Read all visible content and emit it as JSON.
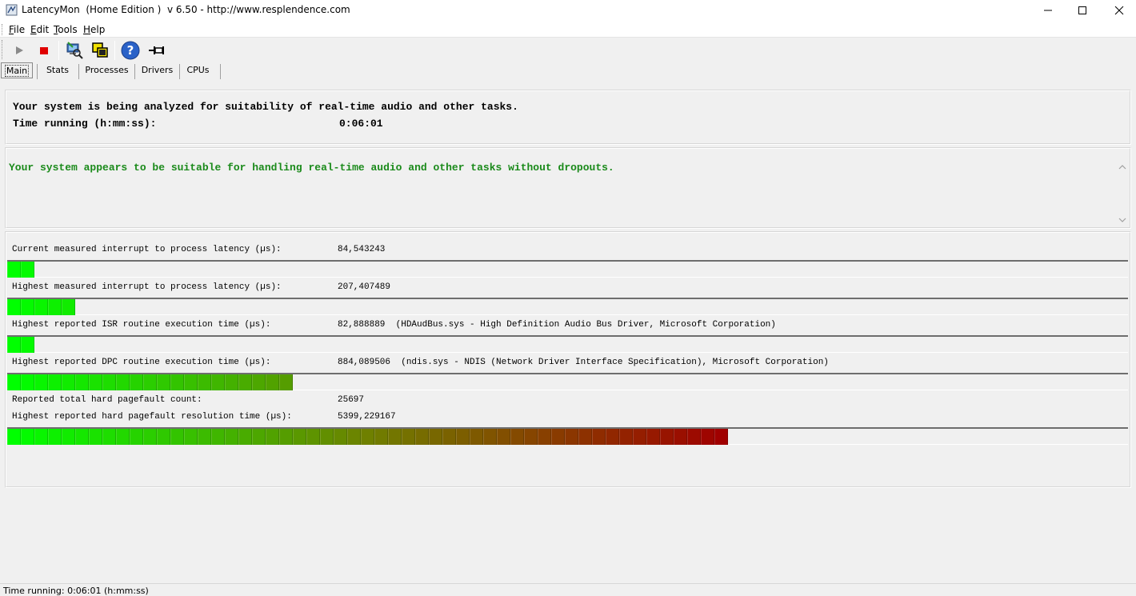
{
  "window": {
    "title": "LatencyMon  (Home Edition )  v 6.50 - http://www.resplendence.com"
  },
  "menu": {
    "items": [
      {
        "label": "File",
        "mnemonic": "F",
        "rest": "ile"
      },
      {
        "label": "Edit",
        "mnemonic": "E",
        "rest": "dit"
      },
      {
        "label": "Tools",
        "mnemonic": "T",
        "rest": "ools"
      },
      {
        "label": "Help",
        "mnemonic": "H",
        "rest": "elp"
      }
    ]
  },
  "toolbar": {
    "icons": [
      "play-icon",
      "stop-icon",
      "computer-magnify-icon",
      "windows-overlap-icon",
      "help-icon",
      "pin-icon"
    ]
  },
  "tabs": {
    "items": [
      {
        "label": "Main",
        "active": true
      },
      {
        "label": "Stats",
        "active": false
      },
      {
        "label": "Processes",
        "active": false
      },
      {
        "label": "Drivers",
        "active": false
      },
      {
        "label": "CPUs",
        "active": false
      }
    ]
  },
  "analysis": {
    "line1": "Your system is being analyzed for suitability of real-time audio and other tasks.",
    "time_label": "Time running (h:mm:ss):",
    "time_value": "0:06:01"
  },
  "verdict": {
    "text": "Your system appears to be suitable for handling real-time audio and other tasks without dropouts.",
    "color": "#1a8a1a"
  },
  "metrics": {
    "current_latency": {
      "label": "Current measured interrupt to process latency (µs):",
      "value": "84,543243",
      "segments": 2
    },
    "highest_latency": {
      "label": "Highest measured interrupt to process latency (µs):",
      "value": "207,407489",
      "segments": 5
    },
    "isr": {
      "label": "Highest reported ISR routine execution time (µs):",
      "value": "82,888889  (HDAudBus.sys - High Definition Audio Bus Driver, Microsoft Corporation)",
      "segments": 2
    },
    "dpc": {
      "label": "Highest reported DPC routine execution time (µs):",
      "value": "884,089506  (ndis.sys - NDIS (Network Driver Interface Specification), Microsoft Corporation)",
      "segments": 21
    },
    "pagefault_count": {
      "label": "Reported total hard pagefault count:",
      "value": "25697"
    },
    "pagefault_time": {
      "label": "Highest reported hard pagefault resolution time (µs):",
      "value": "5399,229167",
      "segments": 53
    }
  },
  "meter_colors": {
    "start": "#00ff00",
    "mid": "#6f8000",
    "end": "#a00000"
  },
  "statusbar": {
    "text": "Time running: 0:06:01  (h:mm:ss)"
  }
}
